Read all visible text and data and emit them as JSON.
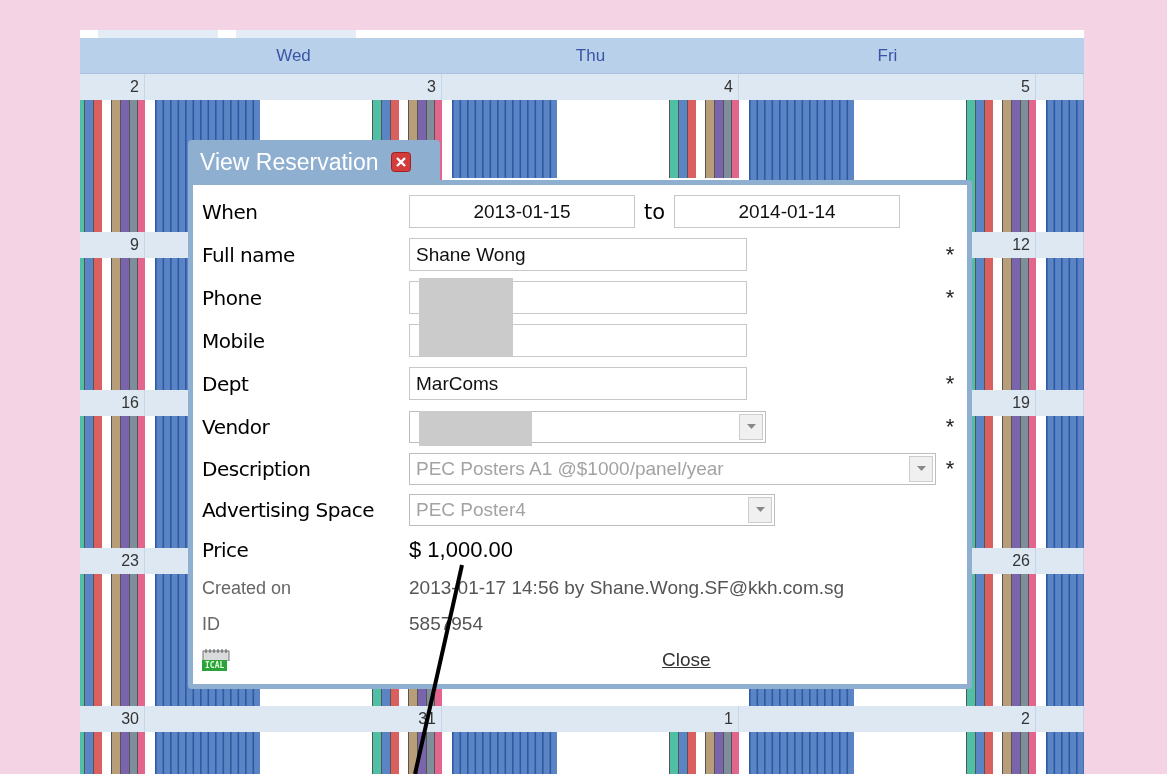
{
  "calendar": {
    "day_headers": [
      "Wed",
      "Thu",
      "Fri"
    ],
    "weeks": [
      {
        "first": "2",
        "middle": [
          "3",
          "4"
        ],
        "last": "5"
      },
      {
        "first": "9",
        "last": "12"
      },
      {
        "first": "16",
        "last": "19"
      },
      {
        "first": "23",
        "last": "26"
      },
      {
        "first": "30",
        "middle": [
          "31",
          "1"
        ],
        "last": "2"
      }
    ]
  },
  "dialog": {
    "title": "View Reservation",
    "rows": [
      {
        "kind": "dates",
        "label": "When",
        "from": "2013-01-15",
        "joiner": "to",
        "until": "2014-01-14"
      },
      {
        "kind": "text",
        "label": "Full name",
        "value": "Shane Wong",
        "marker": "*"
      },
      {
        "kind": "text",
        "label": "Phone",
        "redacted": true,
        "marker": "*"
      },
      {
        "kind": "text",
        "label": "Mobile",
        "redacted": true
      },
      {
        "kind": "text",
        "label": "Dept",
        "value": "MarComs",
        "marker": "*"
      },
      {
        "kind": "select",
        "label": "Vendor",
        "redacted": true,
        "disabled": true,
        "marker": "*"
      },
      {
        "kind": "select",
        "label": "Description",
        "value": "PEC Posters A1 @$1000/panel/year",
        "disabled": true,
        "marker": "*"
      },
      {
        "kind": "select",
        "label": "Advertising Space",
        "value": "PEC Poster4",
        "disabled": true
      },
      {
        "kind": "static",
        "label": "Price",
        "value": "$ 1,000.00"
      },
      {
        "kind": "meta",
        "label": "Created on",
        "value": "2013-01-17 14:56 by Shane.Wong.SF@kkh.com.sg"
      },
      {
        "kind": "meta",
        "label": "ID",
        "value": "5857954"
      }
    ],
    "ical_label": "ICAL",
    "close": "Close"
  },
  "annotation": {
    "kind": "leader-line"
  }
}
